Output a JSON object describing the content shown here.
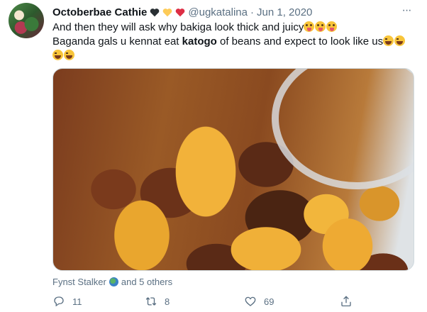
{
  "tweet": {
    "display_name": "Octoberbae Cathie",
    "handle": "@ugkatalina",
    "separator": "·",
    "date": "Jun 1, 2020",
    "more_label": "···",
    "text_line1": "And then they will ask why bakiga look thick and juicy",
    "text_line2_a": "Baganda gals u kennat eat ",
    "text_line2_bold": "katogo",
    "text_line2_b": " of beans and expect to look like us",
    "likers_name": "Fynst Stalker",
    "likers_rest": "and 5 others",
    "reply_count": "11",
    "retweet_count": "8",
    "like_count": "69"
  },
  "icons": {
    "more": "more-horizontal-icon",
    "reply": "reply-icon",
    "retweet": "retweet-icon",
    "like": "heart-icon",
    "share": "share-icon"
  },
  "colors": {
    "text_primary": "#0f1419",
    "text_secondary": "#5b7083",
    "border": "#cfd9de"
  }
}
